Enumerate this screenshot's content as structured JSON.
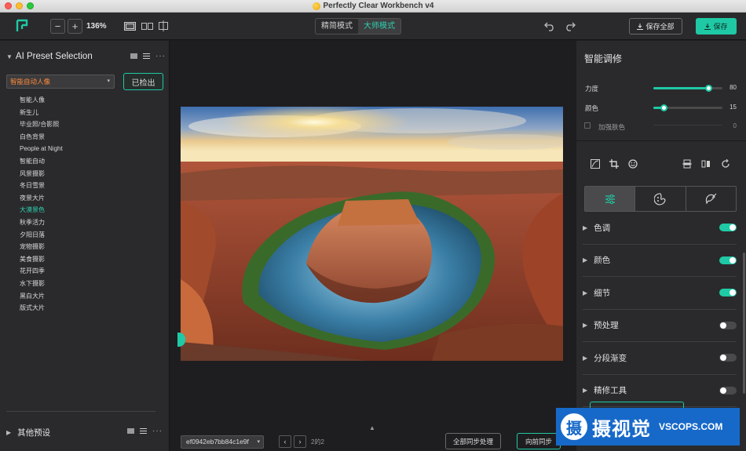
{
  "window": {
    "title": "Perfectly Clear Workbench v4"
  },
  "toolbar": {
    "zoom_out": "−",
    "zoom_in": "+",
    "zoom_level": "136%",
    "mode_simple": "精简模式",
    "mode_master": "大师模式",
    "save_all_label": "保存全部",
    "save_label": "保存",
    "accent": "#1fc9a5"
  },
  "left_panel": {
    "title": "AI Preset Selection",
    "selected_preset": "智能自动人像",
    "checked_out_label": "已检出",
    "presets": [
      "智能人像",
      "新生儿",
      "毕业照/合影照",
      "白色背景",
      "People at Night",
      "智能自动",
      "风景摄影",
      "冬日雪景",
      "夜景大片",
      "大漠景色",
      "秋季活力",
      "夕阳日落",
      "宠物摄影",
      "美食摄影",
      "花开四季",
      "水下摄影",
      "黑白大片",
      "版式大片"
    ],
    "highlighted_preset": "大漠景色",
    "other_presets_title": "其他预设"
  },
  "canvas": {
    "filename": "ef0942eb7bb84c1e9f",
    "page_indicator": "2的2",
    "sync_all_label": "全部同步处理",
    "sync_forward_label": "向前同步"
  },
  "right_panel": {
    "title": "智能调修",
    "sliders": [
      {
        "label": "力度",
        "value": 80,
        "fraction": 0.8
      },
      {
        "label": "颜色",
        "value": 15,
        "fraction": 0.15
      }
    ],
    "skin_label": "加强肤色",
    "skin_value": 0,
    "sections": [
      {
        "label": "色调",
        "on": true
      },
      {
        "label": "颜色",
        "on": true
      },
      {
        "label": "细节",
        "on": true
      },
      {
        "label": "预处理",
        "on": false
      },
      {
        "label": "分段渐变",
        "on": false
      },
      {
        "label": "精修工具",
        "on": false
      }
    ]
  },
  "watermark": {
    "cn": "摄视觉",
    "en": "VSCOPS.COM",
    "logo_char": "摄"
  }
}
